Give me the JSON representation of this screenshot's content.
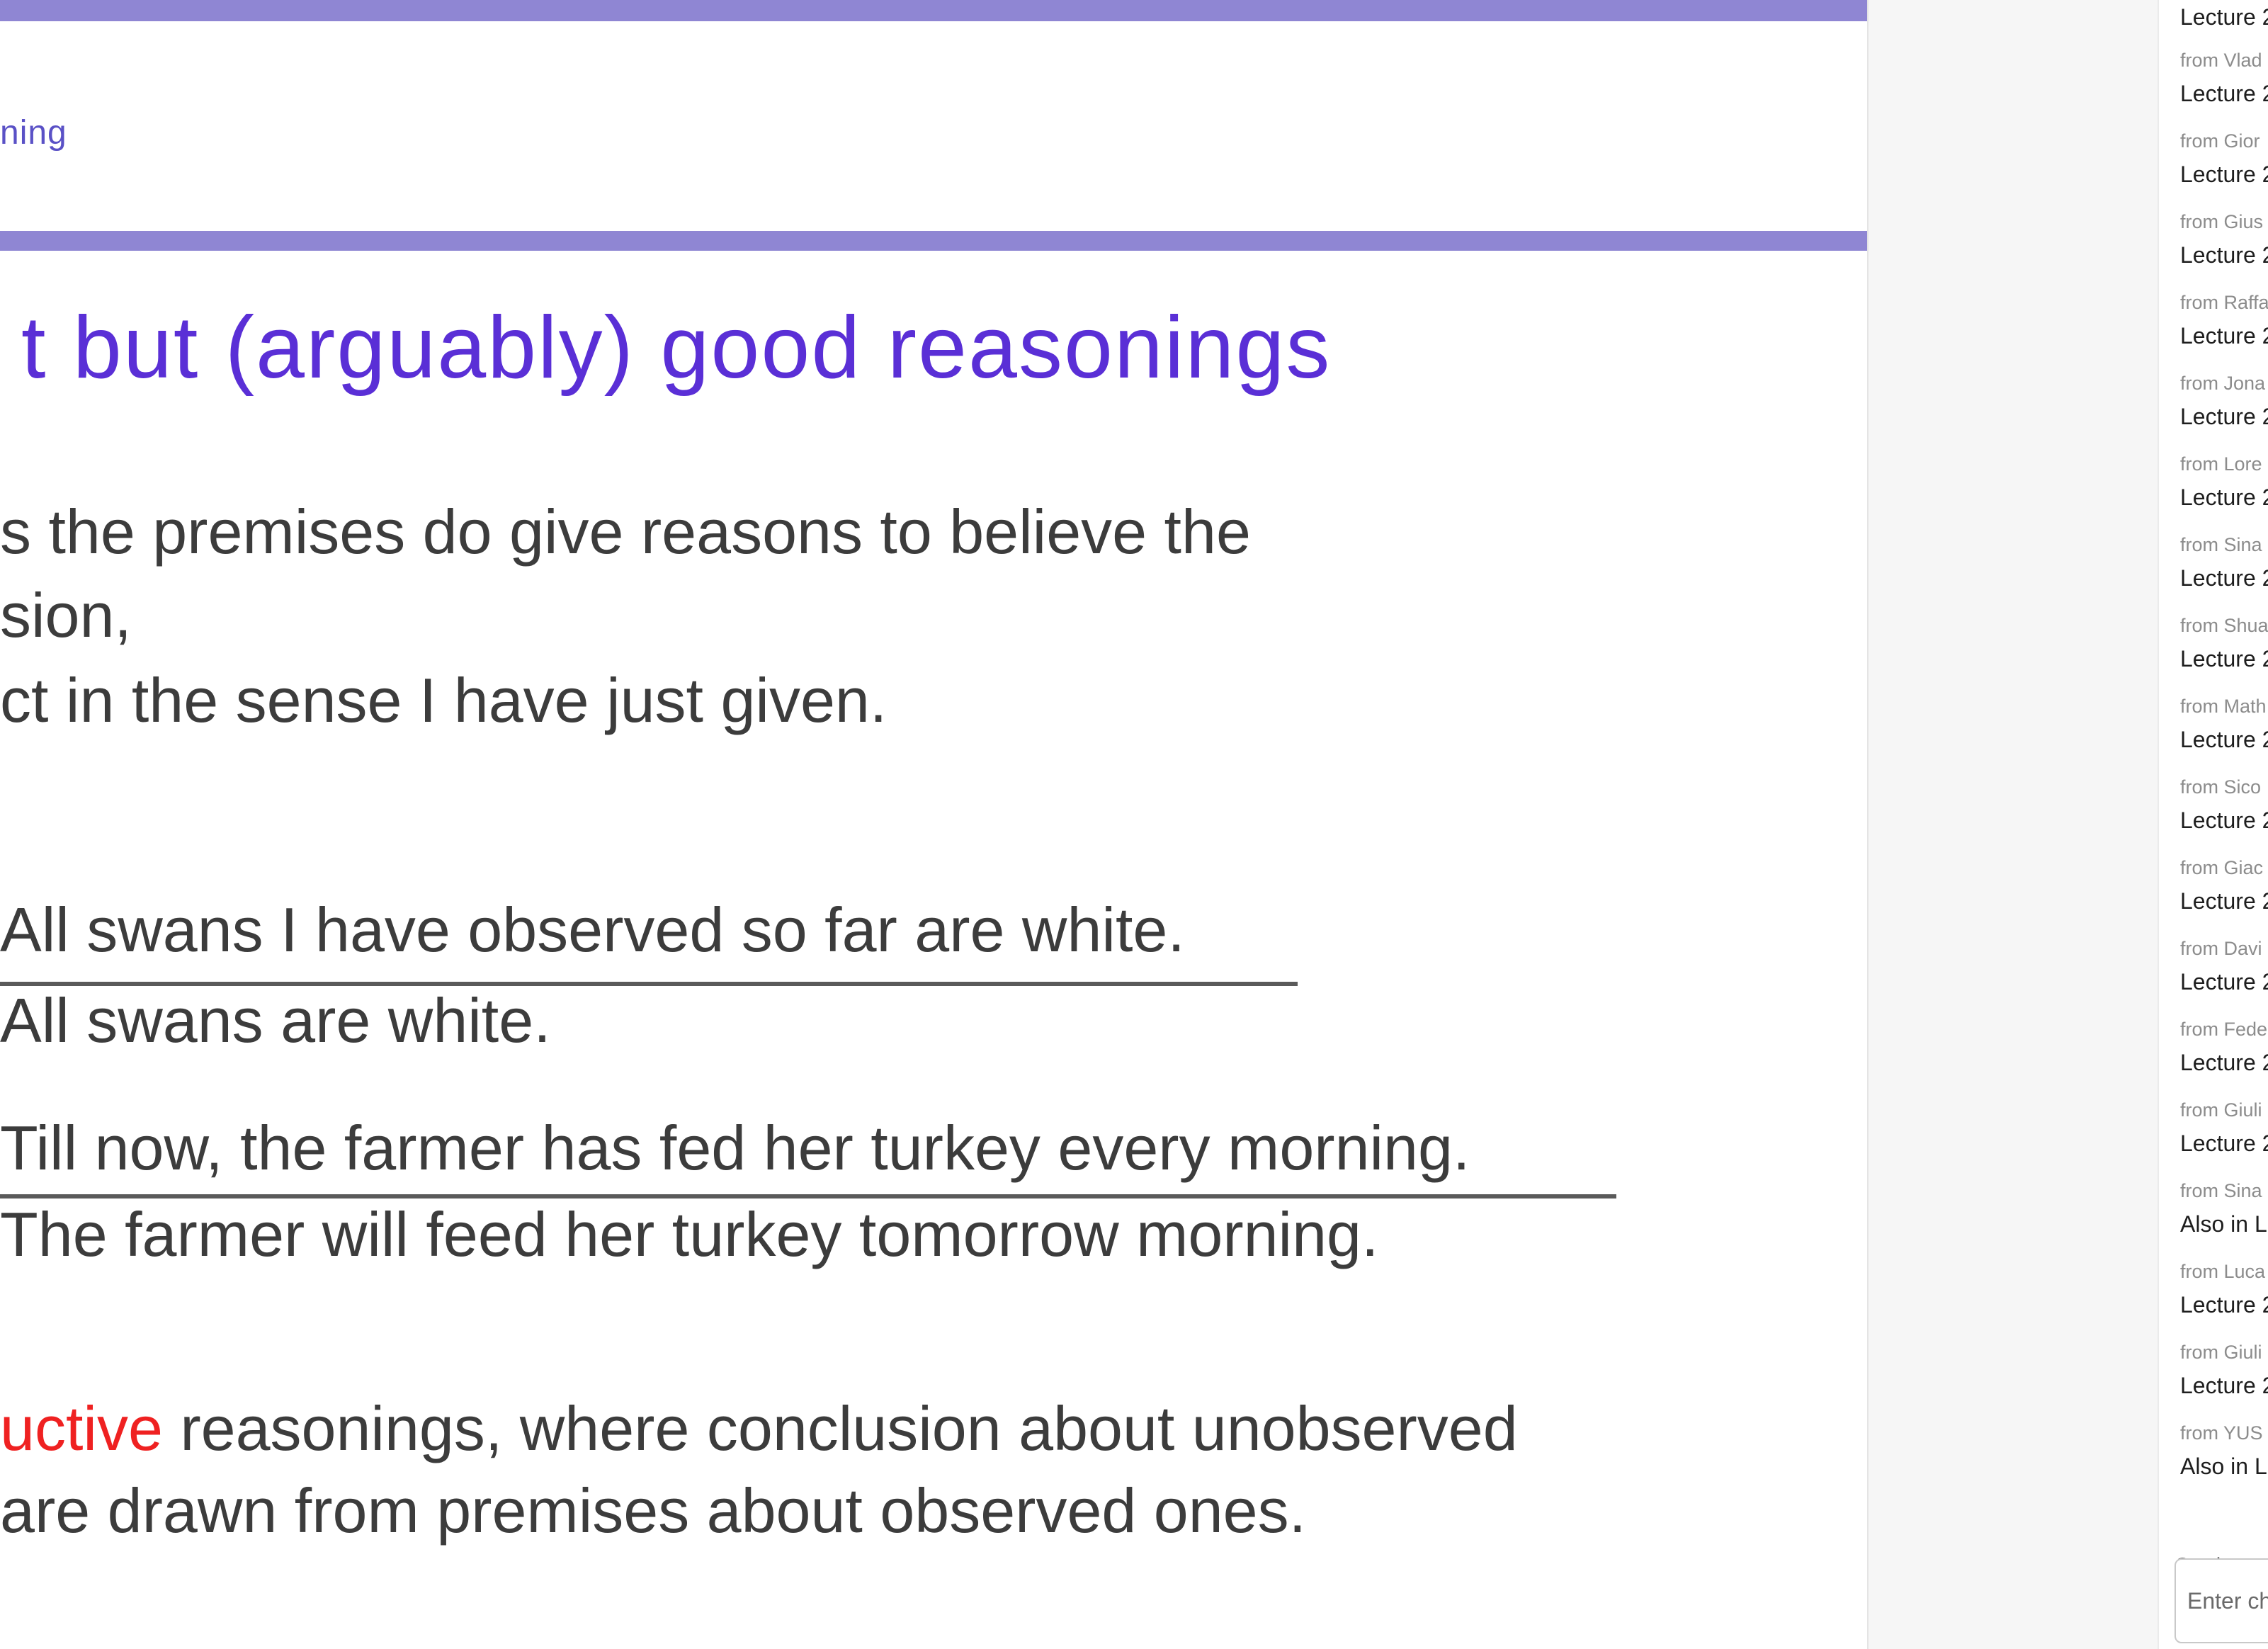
{
  "slide": {
    "section_label": "ning",
    "heading": "t but (arguably) good reasonings",
    "intro_lines": [
      "s the premises do give reasons to believe the",
      "sion,",
      "ct in the sense I have just given."
    ],
    "swan_example": {
      "premise": "All swans I have observed so far are white.",
      "conclusion": "All swans are white."
    },
    "turkey_example": {
      "premise": "Till now, the farmer has fed her turkey every morning.",
      "conclusion": "The farmer will feed her turkey tomorrow morning."
    },
    "induction": {
      "term": "uctive",
      "line1_rest": " reasonings, where conclusion about unobserved",
      "line2": "are drawn from premises about observed ones."
    },
    "colors": {
      "accent_bar": "#8f86d3",
      "heading": "#5a2fd6",
      "highlight": "#ef2121"
    }
  },
  "chat": {
    "top_subject": "Lecture 2",
    "messages": [
      {
        "from": "from Vlad",
        "subject": "Lecture 2"
      },
      {
        "from": "from Gior",
        "subject": "Lecture 2"
      },
      {
        "from": "from Gius",
        "subject": "Lecture 2"
      },
      {
        "from": "from Raffa",
        "subject": "Lecture 2"
      },
      {
        "from": "from Jona",
        "subject": "Lecture 2"
      },
      {
        "from": "from Lore",
        "subject": "Lecture 2"
      },
      {
        "from": "from Sina",
        "subject": "Lecture 2"
      },
      {
        "from": "from Shua",
        "subject": "Lecture 2"
      },
      {
        "from": "from Math",
        "subject": "Lecture 2"
      },
      {
        "from": "from Sico",
        "subject": "Lecture 2"
      },
      {
        "from": "from Giac",
        "subject": "Lecture 2"
      },
      {
        "from": "from Davi",
        "subject": "Lecture 2"
      },
      {
        "from": "from Fede",
        "subject": "Lecture 2"
      },
      {
        "from": "from Giuli",
        "subject": "Lecture 2"
      },
      {
        "from": "from Sina",
        "subject": "Also in Le"
      },
      {
        "from": "from Luca",
        "subject": "Lecture 2"
      },
      {
        "from": "from Giuli",
        "subject": "Lecture 2"
      },
      {
        "from": "from YUS",
        "subject": "Also in Le"
      }
    ],
    "send_to_label": "Send to:",
    "input_placeholder": "Enter ch"
  }
}
